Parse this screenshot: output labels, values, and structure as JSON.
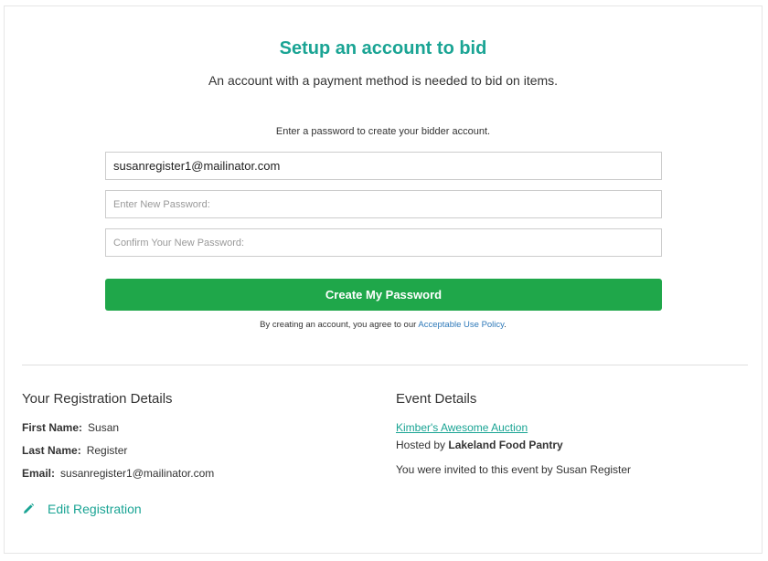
{
  "header": {
    "title": "Setup an account to bid",
    "subtitle": "An account with a payment method is needed to bid on items."
  },
  "form": {
    "instruction": "Enter a password to create your bidder account.",
    "email_value": "susanregister1@mailinator.com",
    "password_placeholder": "Enter New Password:",
    "confirm_placeholder": "Confirm Your New Password:",
    "submit_label": "Create My Password",
    "agree_prefix": "By creating an account, you agree to our ",
    "policy_link": "Acceptable Use Policy",
    "agree_suffix": "."
  },
  "registration": {
    "heading": "Your Registration Details",
    "first_name_label": "First Name:",
    "first_name": "Susan",
    "last_name_label": "Last Name:",
    "last_name": "Register",
    "email_label": "Email:",
    "email": "susanregister1@mailinator.com",
    "edit_label": "Edit Registration",
    "edit_icon": "pencil-icon"
  },
  "event": {
    "heading": "Event Details",
    "name": "Kimber's Awesome Auction",
    "hosted_prefix": "Hosted by ",
    "host": "Lakeland Food Pantry",
    "invited_text": "You were invited to this event by Susan Register"
  },
  "colors": {
    "accent": "#1aa494",
    "button": "#1fa74a",
    "link": "#2e79b9"
  }
}
